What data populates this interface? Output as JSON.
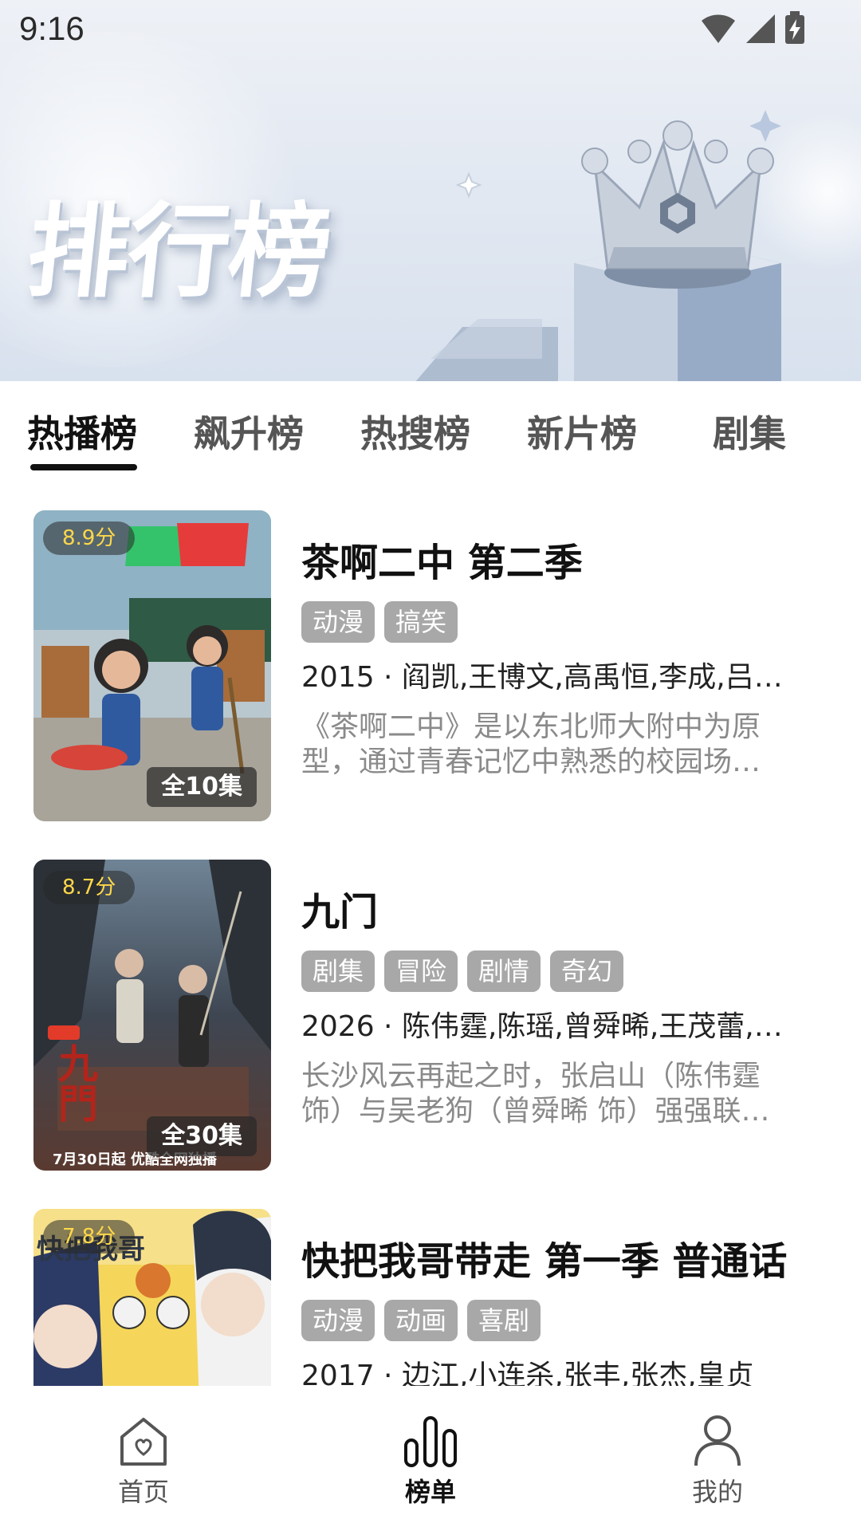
{
  "status_bar": {
    "time": "9:16"
  },
  "banner": {
    "title": "排行榜"
  },
  "tabs": [
    {
      "label": "热播榜",
      "active": true
    },
    {
      "label": "飙升榜",
      "active": false
    },
    {
      "label": "热搜榜",
      "active": false
    },
    {
      "label": "新片榜",
      "active": false
    },
    {
      "label": "剧集",
      "active": false
    }
  ],
  "items": [
    {
      "score": "8.9分",
      "episodes": "全10集",
      "title": "茶啊二中 第二季",
      "tags": [
        "动漫",
        "搞笑"
      ],
      "meta": "2015 · 阎凯,王博文,高禹恒,李成,吕…",
      "description": "《茶啊二中》是以东北师大附中为原型，通过青春记忆中熟悉的校园场…"
    },
    {
      "score": "8.7分",
      "episodes": "全30集",
      "title": "九门",
      "tags": [
        "剧集",
        "冒险",
        "剧情",
        "奇幻"
      ],
      "meta": "2026 · 陈伟霆,陈瑶,曾舜晞,王茂蕾,…",
      "description": "长沙风云再起之时，张启山（陈伟霆 饰）与吴老狗（曾舜晞 饰）强强联…",
      "poster_text_a": "九門",
      "poster_text_b": "7月30日起 优酷全网独播"
    },
    {
      "score": "7.8分",
      "title": "快把我哥带走 第一季 普通话",
      "tags": [
        "动漫",
        "动画",
        "喜剧"
      ],
      "meta": "2017 · 边江,小连杀,张丰,张杰,皇贞"
    }
  ],
  "bottom_nav": [
    {
      "label": "首页",
      "icon": "home-heart-icon",
      "active": false
    },
    {
      "label": "榜单",
      "icon": "chart-bars-icon",
      "active": true
    },
    {
      "label": "我的",
      "icon": "person-icon",
      "active": false
    }
  ],
  "colors": {
    "tag_bg": "#a8a8a8",
    "score_text": "#ffd84a",
    "active_text": "#111111"
  }
}
